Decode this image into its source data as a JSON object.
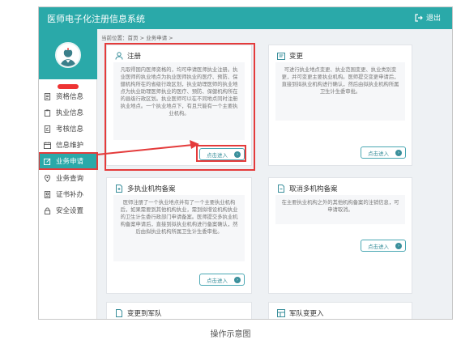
{
  "app": {
    "title": "医师电子化注册信息系统",
    "logout": "退出"
  },
  "breadcrumb": "当前位置：首页 > 业务申请 >",
  "sidebar": {
    "items": [
      {
        "label": "资格信息",
        "icon": "document-icon"
      },
      {
        "label": "执业信息",
        "icon": "clipboard-icon"
      },
      {
        "label": "考核信息",
        "icon": "checklist-icon"
      },
      {
        "label": "信息维护",
        "icon": "calendar-icon"
      },
      {
        "label": "业务申请",
        "icon": "edit-icon",
        "active": true
      },
      {
        "label": "业务查询",
        "icon": "location-icon"
      },
      {
        "label": "证书补办",
        "icon": "certificate-icon"
      },
      {
        "label": "安全设置",
        "icon": "lock-icon"
      }
    ]
  },
  "cards": {
    "register": {
      "title": "注册",
      "desc": "凡取得国内医师资格的，均可申请医师执业注册。执业医师的执业地点为执业医师执业的医疗、预防、保健机构所在的省级行政区划，执业助理医师的执业地点为执业助理医师执业的医疗、预防、保健机构所在的县级行政区划。执业医师可以在不同地点同时注册执业地点。一个执业地点下，有且只能有一个主要执业机构。",
      "button": "点击进入"
    },
    "change": {
      "title": "变更",
      "desc": "可进行执业地点变更、执业范围变更、执业类别变更，并可变更主要执业机构。医师提交变更申请后，直接到拟执业机构进行确认，然后由拟执业机构所属卫生计生委审批。",
      "button": "点击进入"
    },
    "multi": {
      "title": "多执业机构备案",
      "desc": "医师注册了一个执业地点并有了一个主要执业机构后，如果需要到其他机构执业，需到拟增设机构执业的卫生计生委行政部门申请备案。医师提交多执业机构备案申请后，直接到拟执业机构进行备案确认，然后由拟执业机构所属卫生计生委审批。",
      "button": "点击进入"
    },
    "cancel": {
      "title": "取消多机构备案",
      "desc": "在主要执业机构之外的其他机构备案的注销信息，可申请取消。",
      "button": "点击进入"
    },
    "to_army": {
      "title": "变更到军队"
    },
    "army_change": {
      "title": "军队变更入"
    }
  },
  "caption": "操作示意图",
  "colors": {
    "accent": "#2aa9a9",
    "highlight": "#e43b3b"
  }
}
